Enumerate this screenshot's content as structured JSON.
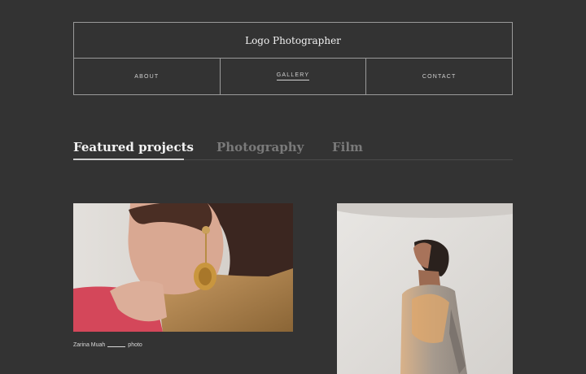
{
  "header": {
    "logo": "Logo Photographer",
    "nav": [
      {
        "label": "ABOUT"
      },
      {
        "label": "GALLERY"
      },
      {
        "label": "CONTACT"
      }
    ]
  },
  "tabs": [
    {
      "label": "Featured projects"
    },
    {
      "label": "Photography"
    },
    {
      "label": "Film"
    }
  ],
  "gallery": {
    "caption_name": "Zarina Muah",
    "caption_suffix": "photo"
  },
  "colors": {
    "background": "#333333",
    "text_primary": "#f2f2f2",
    "text_muted": "#7a7a7a",
    "border": "#9a9a9a"
  }
}
